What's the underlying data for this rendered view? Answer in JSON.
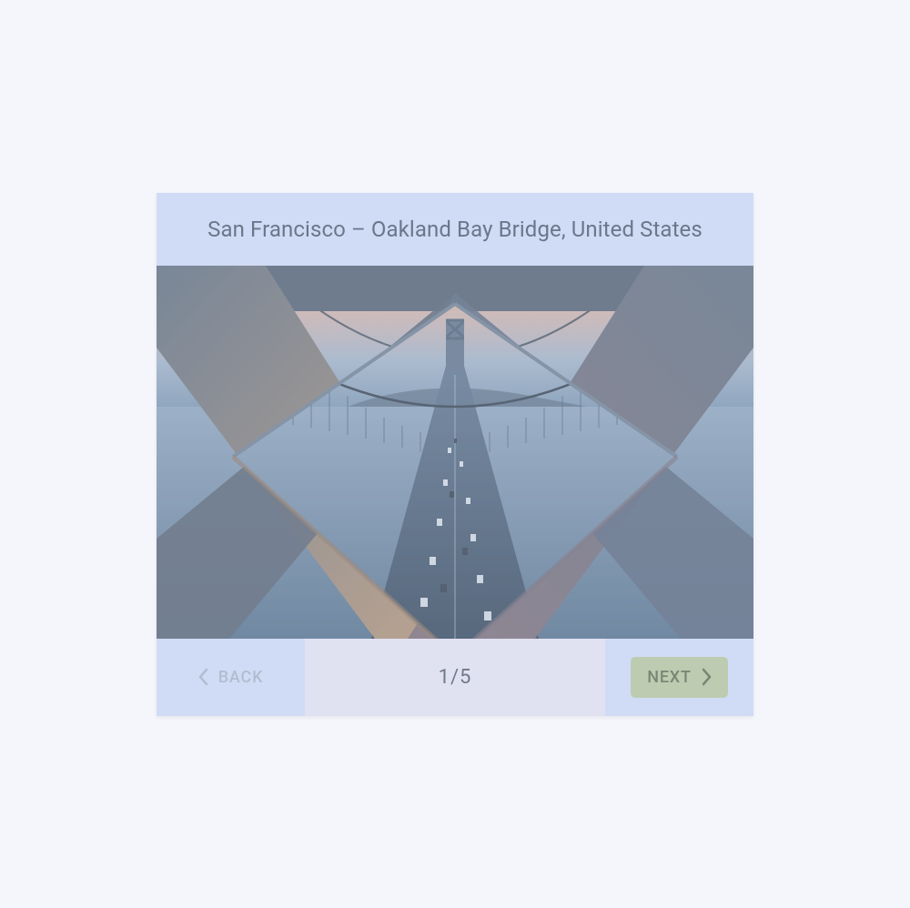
{
  "header": {
    "title": "San Francisco – Oakland Bay Bridge, United States"
  },
  "stepper": {
    "current": "1",
    "separator": " / ",
    "total": "5",
    "back_label": "BACK",
    "next_label": "NEXT"
  },
  "colors": {
    "card_bg": "#cfddf6",
    "center_bg": "#e5e3f0",
    "next_bg": "#b6c79a",
    "back_text": "#a8b3c5",
    "title_text": "#4a5568"
  }
}
